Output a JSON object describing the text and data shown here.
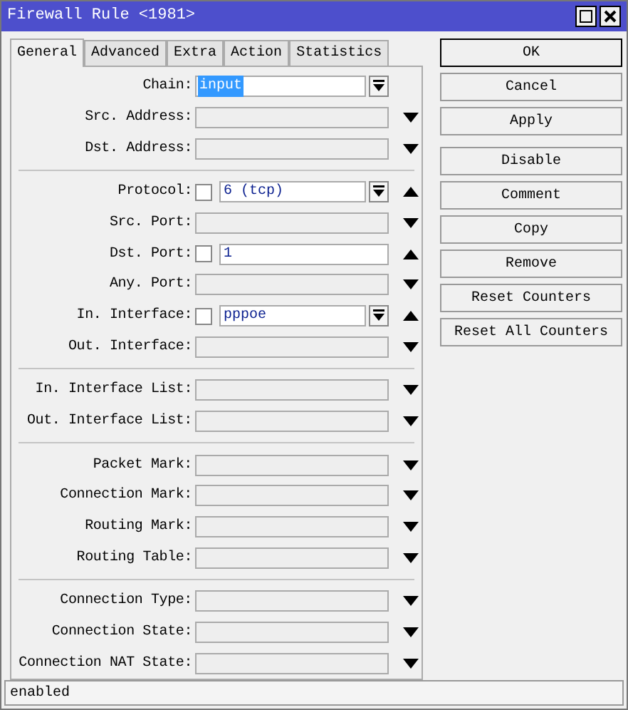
{
  "window": {
    "title": "Firewall Rule <1981>"
  },
  "tabs": [
    {
      "label": "General",
      "selected": true
    },
    {
      "label": "Advanced",
      "selected": false
    },
    {
      "label": "Extra",
      "selected": false
    },
    {
      "label": "Action",
      "selected": false
    },
    {
      "label": "Statistics",
      "selected": false
    }
  ],
  "sections": [
    {
      "rows": [
        {
          "label": "Chain:",
          "value": "input",
          "value_selected": true,
          "dropdown": true
        },
        {
          "label": "Src. Address:",
          "expanded": false
        },
        {
          "label": "Dst. Address:",
          "expanded": false
        }
      ]
    },
    {
      "rows": [
        {
          "label": "Protocol:",
          "negate": false,
          "value": "6 (tcp)",
          "dropdown": true,
          "expanded": true
        },
        {
          "label": "Src. Port:",
          "expanded": false
        },
        {
          "label": "Dst. Port:",
          "negate": false,
          "value": "1",
          "expanded": true
        },
        {
          "label": "Any. Port:",
          "expanded": false
        },
        {
          "label": "In. Interface:",
          "negate": false,
          "value": "pppoe",
          "dropdown": true,
          "expanded": true
        },
        {
          "label": "Out. Interface:",
          "expanded": false
        }
      ]
    },
    {
      "rows": [
        {
          "label": "In. Interface List:",
          "expanded": false
        },
        {
          "label": "Out. Interface List:",
          "expanded": false
        }
      ]
    },
    {
      "rows": [
        {
          "label": "Packet Mark:",
          "expanded": false
        },
        {
          "label": "Connection Mark:",
          "expanded": false
        },
        {
          "label": "Routing Mark:",
          "expanded": false
        },
        {
          "label": "Routing Table:",
          "expanded": false
        }
      ]
    },
    {
      "rows": [
        {
          "label": "Connection Type:",
          "expanded": false
        },
        {
          "label": "Connection State:",
          "expanded": false
        },
        {
          "label": "Connection NAT State:",
          "expanded": false
        }
      ]
    }
  ],
  "button_groups": [
    {
      "buttons": [
        {
          "label": "OK",
          "default": true
        },
        {
          "label": "Cancel",
          "default": false
        },
        {
          "label": "Apply",
          "default": false
        }
      ]
    },
    {
      "buttons": [
        {
          "label": "Disable",
          "default": false
        },
        {
          "label": "Comment",
          "default": false
        },
        {
          "label": "Copy",
          "default": false
        },
        {
          "label": "Remove",
          "default": false
        },
        {
          "label": "Reset Counters",
          "default": false
        },
        {
          "label": "Reset All Counters",
          "default": false
        }
      ]
    }
  ],
  "status_bar": {
    "text": "enabled"
  }
}
